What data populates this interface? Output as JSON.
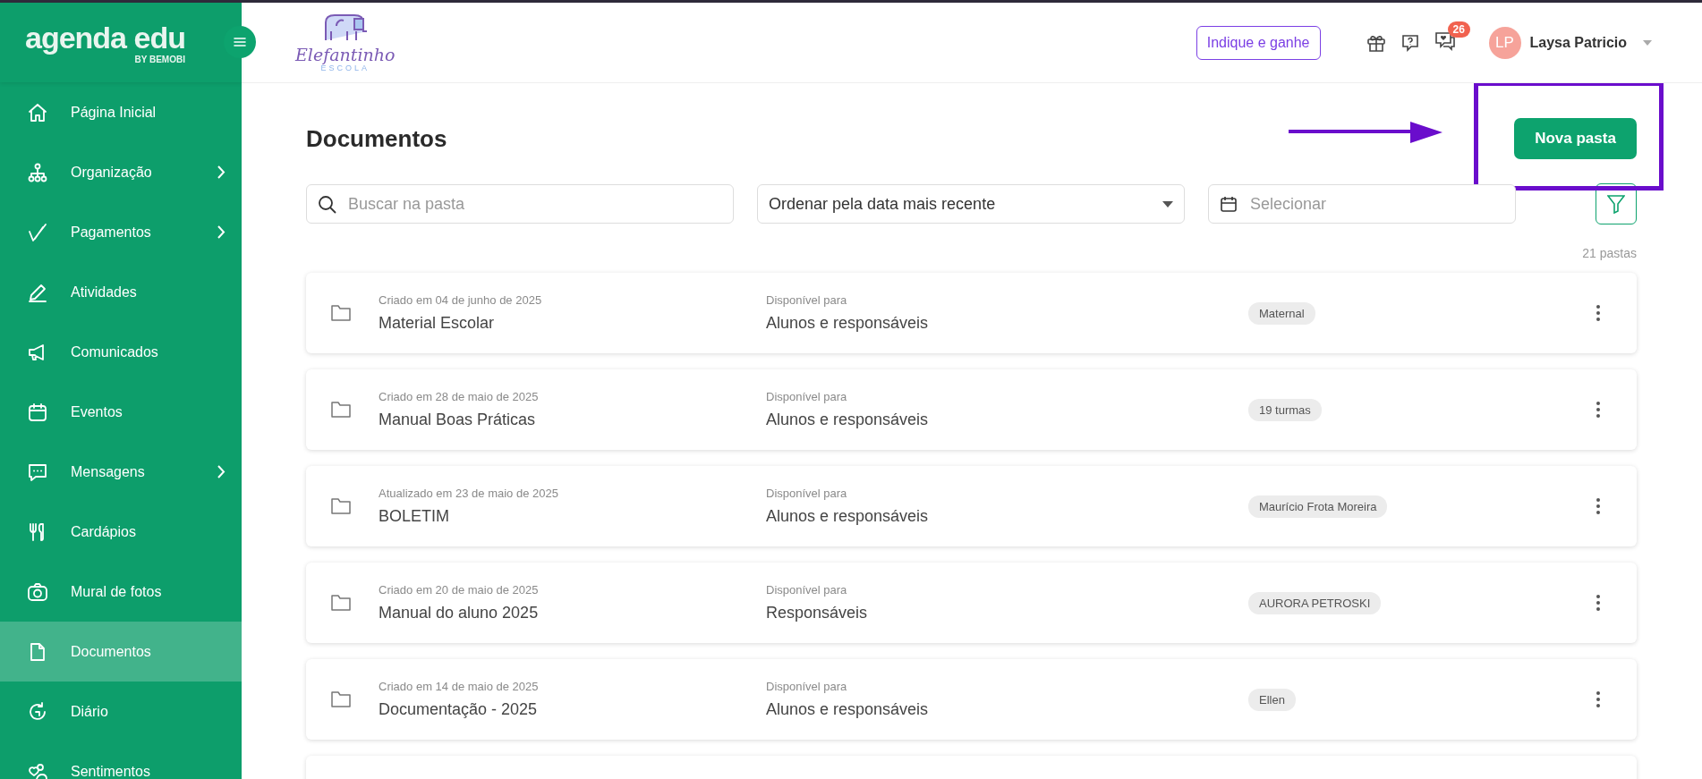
{
  "sidebar": {
    "logo": {
      "name": "agenda edu",
      "byline": "BY BEMOBI"
    },
    "items": [
      {
        "label": "Página Inicial",
        "submenu": false,
        "selected": false
      },
      {
        "label": "Organização",
        "submenu": true,
        "selected": false
      },
      {
        "label": "Pagamentos",
        "submenu": true,
        "selected": false
      },
      {
        "label": "Atividades",
        "submenu": false,
        "selected": false
      },
      {
        "label": "Comunicados",
        "submenu": false,
        "selected": false
      },
      {
        "label": "Eventos",
        "submenu": false,
        "selected": false
      },
      {
        "label": "Mensagens",
        "submenu": true,
        "selected": false
      },
      {
        "label": "Cardápios",
        "submenu": false,
        "selected": false
      },
      {
        "label": "Mural de fotos",
        "submenu": false,
        "selected": false
      },
      {
        "label": "Documentos",
        "submenu": false,
        "selected": true
      },
      {
        "label": "Diário",
        "submenu": false,
        "selected": false
      },
      {
        "label": "Sentimentos",
        "submenu": false,
        "selected": false
      }
    ]
  },
  "header": {
    "school_logo": {
      "name": "Elefantinho",
      "subtitle": "ESCOLA"
    },
    "referral_button": "Indique e ganhe",
    "messages_badge": "26",
    "user": {
      "initials": "LP",
      "name": "Laysa Patricio"
    }
  },
  "page": {
    "title": "Documentos",
    "new_folder_button": "Nova pasta",
    "search": {
      "placeholder": "Buscar na pasta"
    },
    "sort": {
      "value": "Ordenar pela data mais recente"
    },
    "date": {
      "placeholder": "Selecionar"
    },
    "count": "21 pastas",
    "folders": [
      {
        "meta": "Criado em 04 de junho de 2025",
        "name": "Material Escolar",
        "availability_label": "Disponível para",
        "availability": "Alunos e responsáveis",
        "tag": "Maternal"
      },
      {
        "meta": "Criado em 28 de maio de 2025",
        "name": "Manual Boas Práticas",
        "availability_label": "Disponível para",
        "availability": "Alunos e responsáveis",
        "tag": "19 turmas"
      },
      {
        "meta": "Atualizado em 23 de maio de 2025",
        "name": "BOLETIM",
        "availability_label": "Disponível para",
        "availability": "Alunos e responsáveis",
        "tag": "Maurício Frota Moreira"
      },
      {
        "meta": "Criado em 20 de maio de 2025",
        "name": "Manual do aluno 2025",
        "availability_label": "Disponível para",
        "availability": "Responsáveis",
        "tag": "AURORA PETROSKI"
      },
      {
        "meta": "Criado em 14 de maio de 2025",
        "name": "Documentação - 2025",
        "availability_label": "Disponível para",
        "availability": "Alunos e responsáveis",
        "tag": "Ellen"
      }
    ]
  }
}
